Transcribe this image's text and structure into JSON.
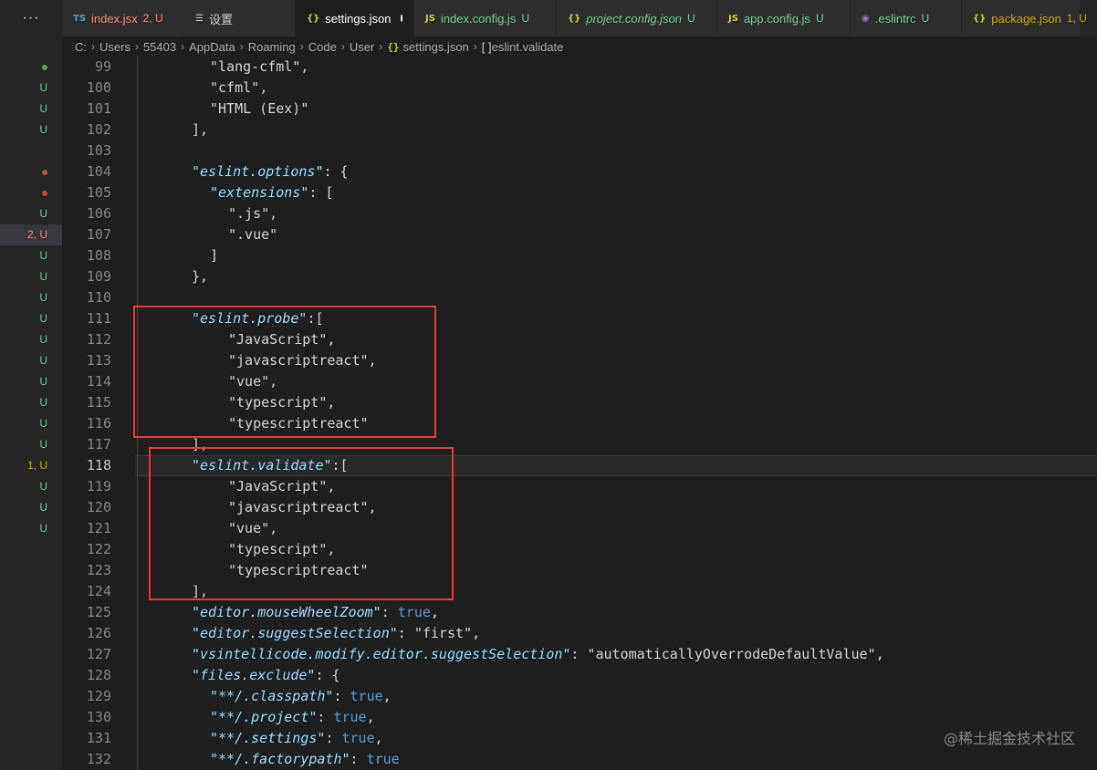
{
  "side_strip": {
    "more_label": "···",
    "marks": [
      {
        "text": "",
        "color": "#6a9955",
        "dot": true
      },
      {
        "text": "U",
        "color": "#73c991"
      },
      {
        "text": "U",
        "color": "#73c991"
      },
      {
        "text": "U",
        "color": "#73c991"
      },
      {
        "text": "",
        "color": "",
        "dot": false
      },
      {
        "text": "",
        "color": "#c74e39",
        "dot": true
      },
      {
        "text": "",
        "color": "#c74e39",
        "dot": true
      },
      {
        "text": "U",
        "color": "#73c991"
      },
      {
        "text": "2, U",
        "color": "#f48771",
        "active": true
      },
      {
        "text": "U",
        "color": "#73c991"
      },
      {
        "text": "U",
        "color": "#73c991"
      },
      {
        "text": "U",
        "color": "#73c991"
      },
      {
        "text": "U",
        "color": "#73c991"
      },
      {
        "text": "U",
        "color": "#73c991"
      },
      {
        "text": "U",
        "color": "#73c991"
      },
      {
        "text": "U",
        "color": "#73c991"
      },
      {
        "text": "U",
        "color": "#73c991"
      },
      {
        "text": "U",
        "color": "#73c991"
      },
      {
        "text": "U",
        "color": "#73c991"
      },
      {
        "text": "1, U",
        "color": "#cca700"
      },
      {
        "text": "U",
        "color": "#73c991"
      },
      {
        "text": "U",
        "color": "#73c991"
      },
      {
        "text": "U",
        "color": "#73c991"
      }
    ]
  },
  "tabs": [
    {
      "icon": "TS",
      "icon_color": "#519aba",
      "label": "index.jsx",
      "badge": "2, U",
      "label_color": "#f48771",
      "badge_color": "#f48771",
      "italic": false,
      "active": false
    },
    {
      "icon": "☰",
      "icon_color": "#cccccc",
      "label": "设置",
      "badge": "",
      "label_color": "#cccccc",
      "badge_color": "",
      "italic": false,
      "active": false
    },
    {
      "icon": "{}",
      "icon_color": "#cbcb41",
      "label": "settings.json",
      "badge": "",
      "label_color": "#ffffff",
      "badge_color": "",
      "italic": false,
      "active": true,
      "dirty": true
    },
    {
      "icon": "JS",
      "icon_color": "#cbcb41",
      "label": "index.config.js",
      "badge": "U",
      "label_color": "#73c991",
      "badge_color": "#73c991",
      "italic": false,
      "active": false
    },
    {
      "icon": "{}",
      "icon_color": "#cbcb41",
      "label": "project.config.json",
      "badge": "U",
      "label_color": "#73c991",
      "badge_color": "#73c991",
      "italic": true,
      "active": false
    },
    {
      "icon": "JS",
      "icon_color": "#cbcb41",
      "label": "app.config.js",
      "badge": "U",
      "label_color": "#73c991",
      "badge_color": "#73c991",
      "italic": false,
      "active": false
    },
    {
      "icon": "◉",
      "icon_color": "#a074c4",
      "label": ".eslintrc",
      "badge": "U",
      "label_color": "#73c991",
      "badge_color": "#73c991",
      "italic": false,
      "active": false
    },
    {
      "icon": "{}",
      "icon_color": "#cbcb41",
      "label": "package.json",
      "badge": "1, U",
      "label_color": "#cca700",
      "badge_color": "#cca700",
      "italic": false,
      "active": false
    }
  ],
  "breadcrumb": {
    "segments": [
      "C:",
      "Users",
      "55403",
      "AppData",
      "Roaming",
      "Code",
      "User"
    ],
    "file_icon": "{}",
    "file": "settings.json",
    "symbol_icon": "[ ]",
    "symbol": "eslint.validate"
  },
  "editor": {
    "current_line": 118,
    "lines": [
      {
        "no": 99,
        "indent": 6,
        "tokens": [
          {
            "t": "\"lang-cfml\"",
            "c": "str-plain"
          },
          {
            "t": ",",
            "c": "punc"
          }
        ]
      },
      {
        "no": 100,
        "indent": 6,
        "tokens": [
          {
            "t": "\"cfml\"",
            "c": "str-plain"
          },
          {
            "t": ",",
            "c": "punc"
          }
        ]
      },
      {
        "no": 101,
        "indent": 6,
        "tokens": [
          {
            "t": "\"HTML (Eex)\"",
            "c": "str-plain"
          }
        ]
      },
      {
        "no": 102,
        "indent": 4,
        "tokens": [
          {
            "t": "],",
            "c": "punc"
          }
        ]
      },
      {
        "no": 103,
        "indent": 0,
        "tokens": []
      },
      {
        "no": 104,
        "indent": 4,
        "tokens": [
          {
            "t": "\"eslint.options\"",
            "c": "key"
          },
          {
            "t": ": {",
            "c": "punc"
          }
        ]
      },
      {
        "no": 105,
        "indent": 6,
        "tokens": [
          {
            "t": "\"extensions\"",
            "c": "key"
          },
          {
            "t": ": [",
            "c": "punc"
          }
        ]
      },
      {
        "no": 106,
        "indent": 8,
        "tokens": [
          {
            "t": "\".js\"",
            "c": "str-plain"
          },
          {
            "t": ",",
            "c": "punc"
          }
        ]
      },
      {
        "no": 107,
        "indent": 8,
        "tokens": [
          {
            "t": "\".vue\"",
            "c": "str-plain"
          }
        ]
      },
      {
        "no": 108,
        "indent": 6,
        "tokens": [
          {
            "t": "]",
            "c": "punc"
          }
        ]
      },
      {
        "no": 109,
        "indent": 4,
        "tokens": [
          {
            "t": "},",
            "c": "punc"
          }
        ]
      },
      {
        "no": 110,
        "indent": 0,
        "tokens": []
      },
      {
        "no": 111,
        "indent": 4,
        "tokens": [
          {
            "t": "\"eslint.probe\"",
            "c": "key"
          },
          {
            "t": ":[",
            "c": "punc"
          }
        ]
      },
      {
        "no": 112,
        "indent": 8,
        "tokens": [
          {
            "t": "\"JavaScript\"",
            "c": "str-plain"
          },
          {
            "t": ",",
            "c": "punc"
          }
        ]
      },
      {
        "no": 113,
        "indent": 8,
        "tokens": [
          {
            "t": "\"javascriptreact\"",
            "c": "str-plain"
          },
          {
            "t": ",",
            "c": "punc"
          }
        ]
      },
      {
        "no": 114,
        "indent": 8,
        "tokens": [
          {
            "t": "\"vue\"",
            "c": "str-plain"
          },
          {
            "t": ",",
            "c": "punc"
          }
        ]
      },
      {
        "no": 115,
        "indent": 8,
        "tokens": [
          {
            "t": "\"typescript\"",
            "c": "str-plain"
          },
          {
            "t": ",",
            "c": "punc"
          }
        ]
      },
      {
        "no": 116,
        "indent": 8,
        "tokens": [
          {
            "t": "\"typescriptreact\"",
            "c": "str-plain"
          }
        ]
      },
      {
        "no": 117,
        "indent": 4,
        "tokens": [
          {
            "t": "],",
            "c": "punc"
          }
        ]
      },
      {
        "no": 118,
        "indent": 4,
        "tokens": [
          {
            "t": "\"eslint.validate\"",
            "c": "key"
          },
          {
            "t": ":[",
            "c": "punc"
          }
        ]
      },
      {
        "no": 119,
        "indent": 8,
        "tokens": [
          {
            "t": "\"JavaScript\"",
            "c": "str-plain"
          },
          {
            "t": ",",
            "c": "punc"
          }
        ]
      },
      {
        "no": 120,
        "indent": 8,
        "tokens": [
          {
            "t": "\"javascriptreact\"",
            "c": "str-plain"
          },
          {
            "t": ",",
            "c": "punc"
          }
        ]
      },
      {
        "no": 121,
        "indent": 8,
        "tokens": [
          {
            "t": "\"vue\"",
            "c": "str-plain"
          },
          {
            "t": ",",
            "c": "punc"
          }
        ]
      },
      {
        "no": 122,
        "indent": 8,
        "tokens": [
          {
            "t": "\"typescript\"",
            "c": "str-plain"
          },
          {
            "t": ",",
            "c": "punc"
          }
        ]
      },
      {
        "no": 123,
        "indent": 8,
        "tokens": [
          {
            "t": "\"typescriptreact\"",
            "c": "str-plain"
          }
        ]
      },
      {
        "no": 124,
        "indent": 4,
        "tokens": [
          {
            "t": "],",
            "c": "punc"
          }
        ]
      },
      {
        "no": 125,
        "indent": 4,
        "tokens": [
          {
            "t": "\"editor.mouseWheelZoom\"",
            "c": "key"
          },
          {
            "t": ": ",
            "c": "punc"
          },
          {
            "t": "true",
            "c": "bool"
          },
          {
            "t": ",",
            "c": "punc"
          }
        ]
      },
      {
        "no": 126,
        "indent": 4,
        "tokens": [
          {
            "t": "\"editor.suggestSelection\"",
            "c": "key"
          },
          {
            "t": ": ",
            "c": "punc"
          },
          {
            "t": "\"first\"",
            "c": "str-plain"
          },
          {
            "t": ",",
            "c": "punc"
          }
        ]
      },
      {
        "no": 127,
        "indent": 4,
        "tokens": [
          {
            "t": "\"vsintellicode.modify.editor.suggestSelection\"",
            "c": "key"
          },
          {
            "t": ": ",
            "c": "punc"
          },
          {
            "t": "\"automaticallyOverrodeDefaultValue\"",
            "c": "str-plain"
          },
          {
            "t": ",",
            "c": "punc"
          }
        ]
      },
      {
        "no": 128,
        "indent": 4,
        "tokens": [
          {
            "t": "\"files.exclude\"",
            "c": "key"
          },
          {
            "t": ": {",
            "c": "punc"
          }
        ]
      },
      {
        "no": 129,
        "indent": 6,
        "tokens": [
          {
            "t": "\"**/.classpath\"",
            "c": "key"
          },
          {
            "t": ": ",
            "c": "punc"
          },
          {
            "t": "true",
            "c": "bool"
          },
          {
            "t": ",",
            "c": "punc"
          }
        ]
      },
      {
        "no": 130,
        "indent": 6,
        "tokens": [
          {
            "t": "\"**/.project\"",
            "c": "key"
          },
          {
            "t": ": ",
            "c": "punc"
          },
          {
            "t": "true",
            "c": "bool"
          },
          {
            "t": ",",
            "c": "punc"
          }
        ]
      },
      {
        "no": 131,
        "indent": 6,
        "tokens": [
          {
            "t": "\"**/.settings\"",
            "c": "key"
          },
          {
            "t": ": ",
            "c": "punc"
          },
          {
            "t": "true",
            "c": "bool"
          },
          {
            "t": ",",
            "c": "punc"
          }
        ]
      },
      {
        "no": 132,
        "indent": 6,
        "tokens": [
          {
            "t": "\"**/.factorypath\"",
            "c": "key"
          },
          {
            "t": ": ",
            "c": "punc"
          },
          {
            "t": "true",
            "c": "bool"
          }
        ]
      }
    ]
  },
  "highlight_color": "#e8393a",
  "watermark": "@稀土掘金技术社区"
}
